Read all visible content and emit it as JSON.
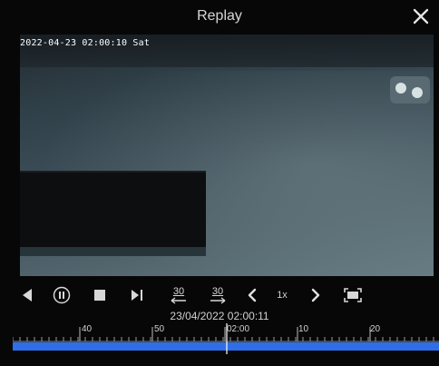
{
  "window": {
    "title": "Replay"
  },
  "video": {
    "osd_timestamp": "2022-04-23 02:00:10 Sat"
  },
  "controls": {
    "rewind_seconds": "30",
    "forward_seconds": "30",
    "speed": "1x"
  },
  "timeline": {
    "current_datetime": "23/04/2022 02:00:11",
    "labels": [
      "40",
      "50",
      "02:00",
      "10",
      "20"
    ],
    "playhead_fraction": 0.5
  },
  "colors": {
    "accent": "#2f6ee8",
    "background": "#070707"
  },
  "icons": [
    "close-icon",
    "play-reverse-icon",
    "pause-icon",
    "stop-icon",
    "step-forward-icon",
    "rewind-30-icon",
    "forward-30-icon",
    "speed-down-icon",
    "speed-up-icon",
    "fullscreen-icon"
  ]
}
